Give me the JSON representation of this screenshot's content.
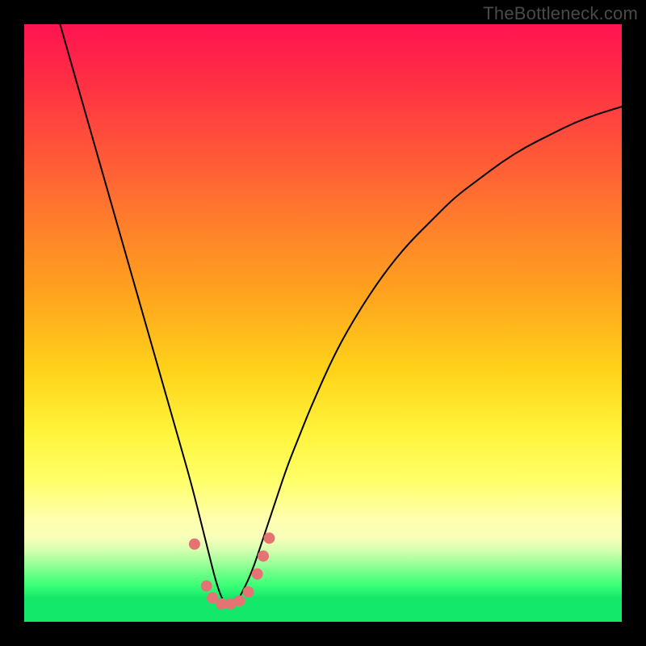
{
  "attribution": "TheBottleneck.com",
  "chart_data": {
    "type": "line",
    "title": "",
    "xlabel": "",
    "ylabel": "",
    "x_range": [
      0,
      100
    ],
    "y_range": [
      0,
      100
    ],
    "background_gradient": {
      "orientation": "vertical",
      "stops": [
        {
          "pos": 0.0,
          "color": "#ff1450"
        },
        {
          "pos": 0.3,
          "color": "#ff7a2d"
        },
        {
          "pos": 0.58,
          "color": "#ffd31a"
        },
        {
          "pos": 0.78,
          "color": "#ffff8c"
        },
        {
          "pos": 0.9,
          "color": "#a3ff9c"
        },
        {
          "pos": 1.0,
          "color": "#14e86b"
        }
      ]
    },
    "series": [
      {
        "name": "bottleneck-curve",
        "color": "#000000",
        "width": 2,
        "x": [
          6,
          8,
          10,
          12,
          14,
          16,
          18,
          20,
          22,
          24,
          26,
          28,
          30,
          31,
          32,
          33,
          34,
          35,
          36,
          38,
          40,
          42,
          44,
          46,
          48,
          52,
          56,
          60,
          64,
          68,
          72,
          76,
          80,
          84,
          88,
          92,
          96,
          100
        ],
        "y": [
          100,
          93,
          86,
          79,
          72,
          65,
          58,
          51,
          44,
          37,
          30,
          23,
          15,
          11,
          7,
          4,
          2.5,
          2.5,
          4,
          8,
          14,
          20,
          26,
          31,
          36,
          45,
          52,
          58,
          63,
          67,
          71,
          74,
          77,
          79.5,
          81.5,
          83.5,
          85,
          86.2
        ]
      }
    ],
    "markers": {
      "name": "highlight-points",
      "color": "#e57373",
      "radius": 7,
      "points": [
        {
          "x": 28.5,
          "y": 13
        },
        {
          "x": 30.5,
          "y": 6
        },
        {
          "x": 31.5,
          "y": 4
        },
        {
          "x": 33.0,
          "y": 3
        },
        {
          "x": 34.5,
          "y": 3
        },
        {
          "x": 36.0,
          "y": 3.5
        },
        {
          "x": 37.5,
          "y": 5
        },
        {
          "x": 39.0,
          "y": 8
        },
        {
          "x": 40.0,
          "y": 11
        },
        {
          "x": 41.0,
          "y": 14
        }
      ]
    }
  }
}
